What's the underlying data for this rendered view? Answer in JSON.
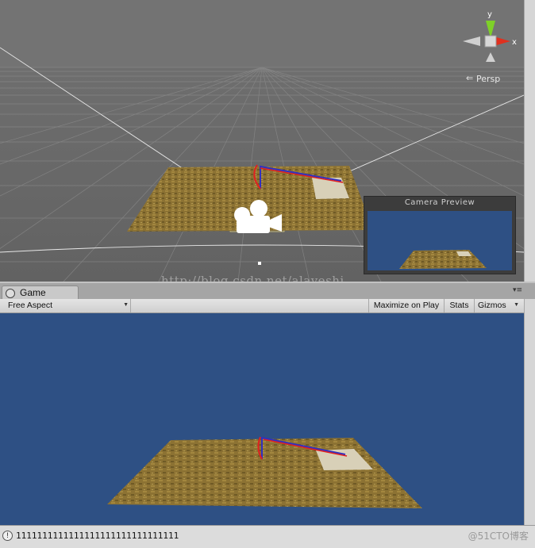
{
  "scene": {
    "persp_label": "Persp",
    "gizmo_axes": {
      "y": "y",
      "x": "x"
    },
    "camera_preview_title": "Camera Preview",
    "watermark": "http://blog.csdn.net/alayeshi"
  },
  "game": {
    "tab_label": "Game",
    "aspect_label": "Free Aspect",
    "maximize_label": "Maximize on Play",
    "stats_label": "Stats",
    "gizmos_label": "Gizmos"
  },
  "status": {
    "info_glyph": "!",
    "message": "1111111111111111111111111111111",
    "watermark": "@51CTO博客"
  },
  "colors": {
    "scene_bg": "#6e6e6e",
    "game_bg": "#2e5084",
    "terrain": "#8a6f2e",
    "axis_x": "#e02020",
    "axis_y": "#3030c0"
  }
}
